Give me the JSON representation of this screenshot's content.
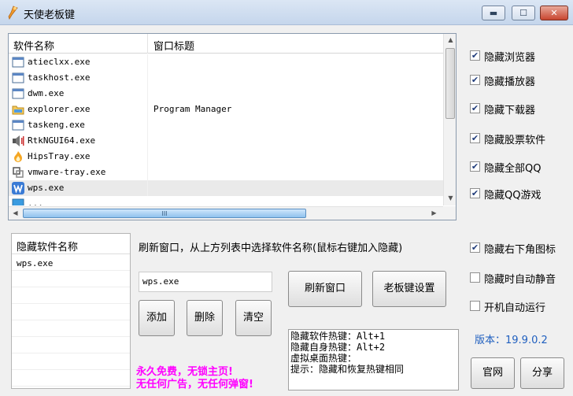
{
  "window": {
    "title": "天使老板键"
  },
  "process_list": {
    "headers": [
      "软件名称",
      "窗口标题"
    ],
    "rows": [
      {
        "name": "atieclxx.exe",
        "title": "",
        "icon": "app-window-icon"
      },
      {
        "name": "taskhost.exe",
        "title": "",
        "icon": "app-window-icon"
      },
      {
        "name": "dwm.exe",
        "title": "",
        "icon": "app-window-icon"
      },
      {
        "name": "explorer.exe",
        "title": "Program Manager",
        "icon": "folder-icon"
      },
      {
        "name": "taskeng.exe",
        "title": "",
        "icon": "app-window-icon"
      },
      {
        "name": "RtkNGUI64.exe",
        "title": "",
        "icon": "speaker-icon"
      },
      {
        "name": "HipsTray.exe",
        "title": "",
        "icon": "flame-icon"
      },
      {
        "name": "vmware-tray.exe",
        "title": "",
        "icon": "vmware-icon"
      },
      {
        "name": "wps.exe",
        "title": "",
        "icon": "wps-icon"
      },
      {
        "name": "...",
        "title": "",
        "icon": "app-window-icon"
      }
    ]
  },
  "options": {
    "top": [
      {
        "label": "隐藏浏览器",
        "checked": true
      },
      {
        "label": "隐藏播放器",
        "checked": true
      },
      {
        "label": "隐藏下载器",
        "checked": true
      },
      {
        "label": "隐藏股票软件",
        "checked": true
      },
      {
        "label": "隐藏全部QQ",
        "checked": true
      },
      {
        "label": "隐藏QQ游戏",
        "checked": true
      }
    ],
    "bottom": [
      {
        "label": "隐藏右下角图标",
        "checked": true
      },
      {
        "label": "隐藏时自动静音",
        "checked": false
      },
      {
        "label": "开机自动运行",
        "checked": false
      }
    ],
    "check_mark": "✔"
  },
  "hidden_list": {
    "header": "隐藏软件名称",
    "items": [
      "wps.exe"
    ]
  },
  "instruction": "刷新窗口，从上方列表中选择软件名称(鼠标右键加入隐藏)",
  "input": {
    "value": "wps.exe"
  },
  "buttons": {
    "add": "添加",
    "delete": "删除",
    "clear": "清空",
    "refresh": "刷新窗口",
    "boss_key_settings": "老板键设置",
    "website": "官网",
    "share": "分享"
  },
  "hotkeys": {
    "lines": [
      "隐藏软件热键：Alt+1",
      "隐藏自身热键：Alt+2",
      "虚拟桌面热键：",
      "提示：隐藏和恢复热键相同"
    ]
  },
  "version": "版本：19.9.0.2",
  "promo": {
    "line1": "永久免费，无锁主页!",
    "line2": "无任何广告，无任何弹窗!"
  },
  "title_buttons": {
    "minimize": "▬",
    "maximize": "☐",
    "close": "✕"
  },
  "scroll": {
    "up": "▲",
    "down": "▼",
    "left": "◀",
    "right": "▶",
    "thumb": "III"
  },
  "colors": {
    "promo": "#ff00ff",
    "version": "#1f5fbf"
  }
}
